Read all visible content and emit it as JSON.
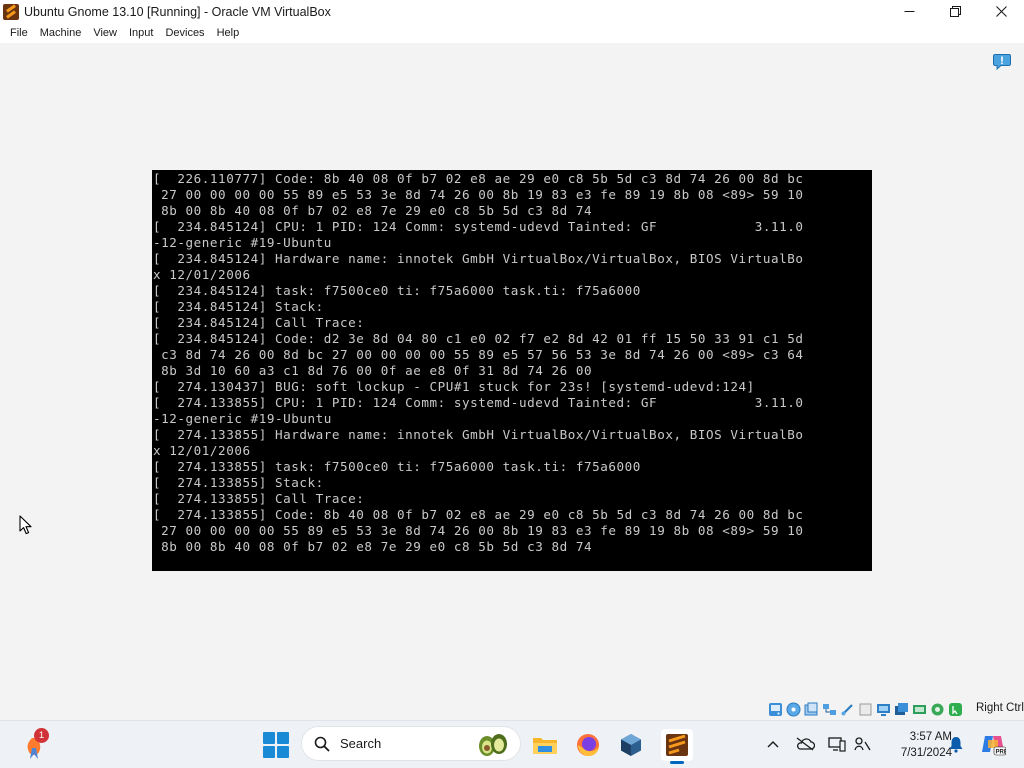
{
  "window": {
    "title": "Ubuntu Gnome 13.10 [Running] - Oracle VM VirtualBox",
    "controls": [
      "minimize",
      "maximize",
      "close"
    ]
  },
  "menu": {
    "items": [
      "File",
      "Machine",
      "View",
      "Input",
      "Devices",
      "Help"
    ]
  },
  "console": {
    "lines": [
      "[  226.110777] Code: 8b 40 08 0f b7 02 e8 ae 29 e0 c8 5b 5d c3 8d 74 26 00 8d bc",
      " 27 00 00 00 00 55 89 e5 53 3e 8d 74 26 00 8b 19 83 e3 fe 89 19 8b 08 <89> 59 10",
      " 8b 00 8b 40 08 0f b7 02 e8 7e 29 e0 c8 5b 5d c3 8d 74",
      "[  234.845124] CPU: 1 PID: 124 Comm: systemd-udevd Tainted: GF            3.11.0",
      "-12-generic #19-Ubuntu",
      "[  234.845124] Hardware name: innotek GmbH VirtualBox/VirtualBox, BIOS VirtualBo",
      "x 12/01/2006",
      "[  234.845124] task: f7500ce0 ti: f75a6000 task.ti: f75a6000",
      "[  234.845124] Stack:",
      "[  234.845124] Call Trace:",
      "[  234.845124] Code: d2 3e 8d 04 80 c1 e0 02 f7 e2 8d 42 01 ff 15 50 33 91 c1 5d",
      " c3 8d 74 26 00 8d bc 27 00 00 00 00 55 89 e5 57 56 53 3e 8d 74 26 00 <89> c3 64",
      " 8b 3d 10 60 a3 c1 8d 76 00 0f ae e8 0f 31 8d 74 26 00",
      "[  274.130437] BUG: soft lockup - CPU#1 stuck for 23s! [systemd-udevd:124]",
      "[  274.133855] CPU: 1 PID: 124 Comm: systemd-udevd Tainted: GF            3.11.0",
      "-12-generic #19-Ubuntu",
      "[  274.133855] Hardware name: innotek GmbH VirtualBox/VirtualBox, BIOS VirtualBo",
      "x 12/01/2006",
      "[  274.133855] task: f7500ce0 ti: f75a6000 task.ti: f75a6000",
      "[  274.133855] Stack:",
      "[  274.133855] Call Trace:",
      "[  274.133855] Code: 8b 40 08 0f b7 02 e8 ae 29 e0 c8 5b 5d c3 8d 74 26 00 8d bc",
      " 27 00 00 00 00 55 89 e5 53 3e 8d 74 26 00 8b 19 83 e3 fe 89 19 8b 08 <89> 59 10",
      " 8b 00 8b 40 08 0f b7 02 e8 7e 29 e0 c8 5b 5d c3 8d 74"
    ]
  },
  "statusbar": {
    "icons": [
      "hard-disk-icon",
      "optical-drive-icon",
      "audio-icon",
      "network-icon",
      "usb-icon",
      "shared-folders-icon",
      "display-icon",
      "video-capture-icon",
      "recording-icon",
      "cpu-icon",
      "mouse-integration-icon",
      "keyboard-icon"
    ],
    "host_key": "Right Ctrl"
  },
  "taskbar": {
    "widgets_badge": "1",
    "search_placeholder": "Search",
    "apps": [
      "file-explorer",
      "firefox",
      "virtualbox",
      "virtualbox-vm-window"
    ],
    "clock_time": "3:57 AM",
    "clock_date": "7/31/2024"
  },
  "colors": {
    "console_bg": "#000000",
    "console_text": "#c9c9c9",
    "accent": "#0067c0"
  }
}
